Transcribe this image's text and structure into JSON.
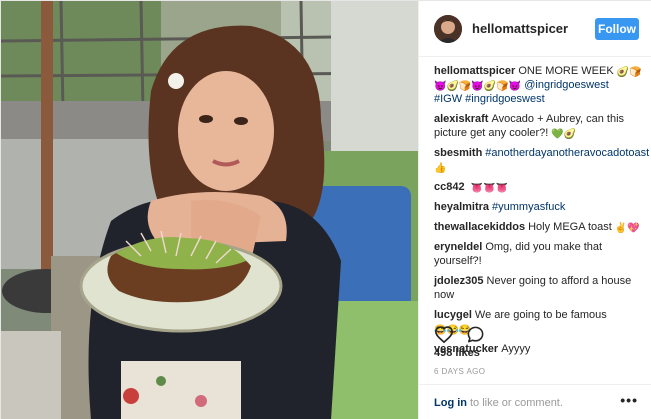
{
  "photo": {
    "alt_icon": "food-photo"
  },
  "header": {
    "username": "hellomattspicer",
    "follow_label": "Follow"
  },
  "caption": {
    "username": "hellomattspicer",
    "text": "ONE MORE WEEK",
    "emojis_1": "🥑🍞",
    "emojis_2": "😈🥑🍞😈🥑🍞😈",
    "mention": "@ingridgoeswest",
    "hashtags": "#IGW #ingridgoeswest"
  },
  "comments": [
    {
      "username": "alexiskraft",
      "text": "Avocado + Aubrey, can this picture get any cooler?!",
      "emoji": "💚🥑"
    },
    {
      "username": "sbesmith",
      "text": "#anotherdayanotheravocadotoast",
      "emoji": "👍"
    },
    {
      "username": "cc842",
      "text": "",
      "emoji": "👅👅👅"
    },
    {
      "username": "heyalmitra",
      "text": "#yummyasfuck",
      "emoji": ""
    },
    {
      "username": "thewallacekiddos",
      "text": "Holy MEGA toast",
      "emoji": "✌️💖"
    },
    {
      "username": "eryneldel",
      "text": "Omg, did you make that yourself?!",
      "emoji": ""
    },
    {
      "username": "jdolez305",
      "text": "Never going to afford a house now",
      "emoji": ""
    },
    {
      "username": "lucygel",
      "text": "We are going to be famous",
      "emoji": "😂😂😂"
    },
    {
      "username": "vesnatucker",
      "text": "Ayyyy",
      "emoji": ""
    }
  ],
  "actions": {
    "like_icon": "heart-icon",
    "comment_icon": "comment-icon"
  },
  "likes": "498 likes",
  "time_ago": "6 DAYS AGO",
  "footer": {
    "login": "Log in",
    "rest": "to like or comment.",
    "more": "•••"
  },
  "colors": {
    "follow": "#3897f0",
    "link": "#003569",
    "meta": "#999999"
  }
}
